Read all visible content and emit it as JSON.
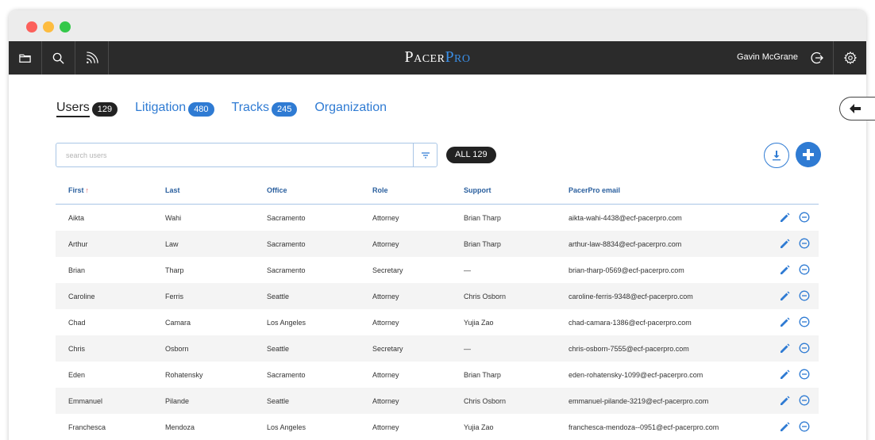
{
  "app": {
    "logo_main": "Pacer",
    "logo_accent": "Pro",
    "user_name": "Gavin McGrane"
  },
  "tabs": [
    {
      "label": "Users",
      "count": "129",
      "active": true
    },
    {
      "label": "Litigation",
      "count": "480",
      "active": false
    },
    {
      "label": "Tracks",
      "count": "245",
      "active": false
    },
    {
      "label": "Organization",
      "count": "",
      "active": false
    }
  ],
  "search": {
    "placeholder": "search users",
    "value": ""
  },
  "filter_pill": "ALL 129",
  "table": {
    "columns": [
      "First",
      "Last",
      "Office",
      "Role",
      "Support",
      "PacerPro email"
    ],
    "sort_indicator": "↑",
    "rows": [
      [
        "Aikta",
        "Wahi",
        "Sacramento",
        "Attorney",
        "Brian Tharp",
        "aikta-wahi-4438@ecf-pacerpro.com"
      ],
      [
        "Arthur",
        "Law",
        "Sacramento",
        "Attorney",
        "Brian Tharp",
        "arthur-law-8834@ecf-pacerpro.com"
      ],
      [
        "Brian",
        "Tharp",
        "Sacramento",
        "Secretary",
        "—",
        "brian-tharp-0569@ecf-pacerpro.com"
      ],
      [
        "Caroline",
        "Ferris",
        "Seattle",
        "Attorney",
        "Chris Osborn",
        "caroline-ferris-9348@ecf-pacerpro.com"
      ],
      [
        "Chad",
        "Camara",
        "Los Angeles",
        "Attorney",
        "Yujia Zao",
        "chad-camara-1386@ecf-pacerpro.com"
      ],
      [
        "Chris",
        "Osborn",
        "Seattle",
        "Secretary",
        "—",
        "chris-osborn-7555@ecf-pacerpro.com"
      ],
      [
        "Eden",
        "Rohatensky",
        "Sacramento",
        "Attorney",
        "Brian Tharp",
        "eden-rohatensky-1099@ecf-pacerpro.com"
      ],
      [
        "Emmanuel",
        "Pilande",
        "Seattle",
        "Attorney",
        "Chris Osborn",
        "emmanuel-pilande-3219@ecf-pacerpro.com"
      ],
      [
        "Franchesca",
        "Mendoza",
        "Los Angeles",
        "Attorney",
        "Yujia Zao",
        "franchesca-mendoza--0951@ecf-pacerpro.com"
      ]
    ]
  },
  "icons": {
    "nav": [
      "folder-icon",
      "search-icon",
      "feed-icon"
    ],
    "row_actions": [
      "pencil-icon",
      "minus-circle-icon"
    ]
  },
  "colors": {
    "accent": "#2f7bd3",
    "navbar": "#2b2b2b",
    "row_alt": "#f4f4f4"
  }
}
